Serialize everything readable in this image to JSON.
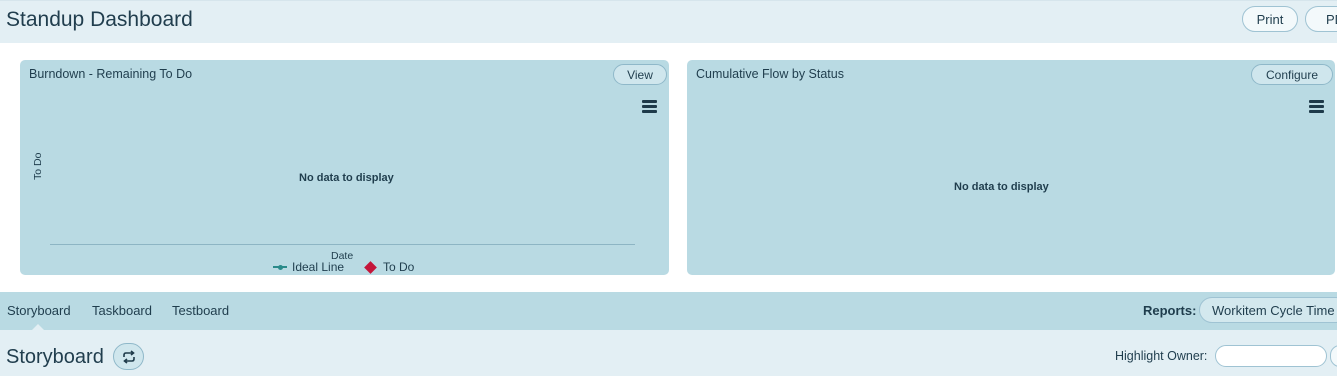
{
  "header": {
    "title": "Standup Dashboard",
    "print_label": "Print",
    "pdf_label": "PD"
  },
  "burndown": {
    "title": "Burndown - Remaining To Do",
    "view_label": "View",
    "no_data": "No data to display",
    "y_label": "To Do",
    "x_label": "Date",
    "legend": [
      "Ideal Line",
      "To Do"
    ]
  },
  "cumulative_flow": {
    "title": "Cumulative Flow by Status",
    "configure_label": "Configure",
    "no_data": "No data to display"
  },
  "tabs": {
    "items": [
      "Storyboard",
      "Taskboard",
      "Testboard"
    ],
    "active": "Storyboard"
  },
  "reports": {
    "label": "Reports:",
    "selected": "Workitem Cycle Time"
  },
  "board": {
    "title": "Storyboard",
    "highlight_owner_label": "Highlight Owner:",
    "highlight_owner_value": ""
  },
  "colors": {
    "accent_panel": "#b9dae3",
    "header_bg": "#e3eff4",
    "ideal_line": "#2a8a8a",
    "todo_marker": "#c4163a"
  }
}
